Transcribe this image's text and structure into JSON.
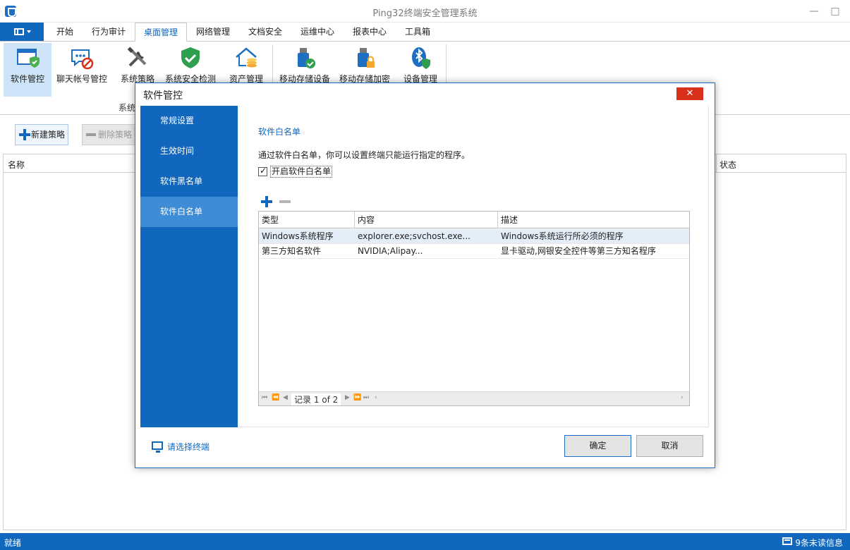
{
  "window": {
    "title": "Ping32终端安全管理系统",
    "minimize": "—",
    "maximize": "□",
    "close": "✕"
  },
  "menu": {
    "tabs": [
      "开始",
      "行为审计",
      "桌面管理",
      "网络管理",
      "文档安全",
      "运维中心",
      "报表中心",
      "工具箱"
    ],
    "active_tab": "桌面管理"
  },
  "ribbon": {
    "items": [
      {
        "label": "软件管控",
        "icon": "software-control-icon"
      },
      {
        "label": "聊天帐号管控",
        "icon": "chat-account-icon"
      },
      {
        "label": "系统策略",
        "icon": "tools-icon"
      },
      {
        "label": "系统安全检测",
        "icon": "shield-check-icon"
      },
      {
        "label": "资产管理",
        "icon": "asset-house-icon"
      },
      {
        "label": "移动存储设备",
        "icon": "usb-check-icon"
      },
      {
        "label": "移动存储加密",
        "icon": "usb-lock-icon"
      },
      {
        "label": "设备管理",
        "icon": "bluetooth-shield-icon"
      }
    ],
    "group_label": "系统"
  },
  "toolbar": {
    "new_policy": "新建策略",
    "delete_policy": "删除策略"
  },
  "grid": {
    "col_name": "名称",
    "col_status": "状态"
  },
  "dialog": {
    "title": "软件管控",
    "close": "✕",
    "side_items": [
      "常规设置",
      "生效时间",
      "软件黑名单",
      "软件白名单"
    ],
    "active_side": "软件白名单",
    "section_title": "软件白名单",
    "description": "通过软件白名单，你可以设置终端只能运行指定的程序。",
    "checkbox_label": "开启软件白名单",
    "table": {
      "headers": [
        "类型",
        "内容",
        "描述"
      ],
      "rows": [
        [
          "Windows系统程序",
          "explorer.exe;svchost.exe...",
          "Windows系统运行所必须的程序"
        ],
        [
          "第三方知名软件",
          "NVIDIA;Alipay...",
          "显卡驱动,网银安全控件等第三方知名程序"
        ]
      ],
      "pager_label": "记录 1 of 2"
    },
    "pick_terminal": "请选择终端",
    "ok": "确定",
    "cancel": "取消"
  },
  "status": {
    "left": "就绪",
    "right": "9条未读信息"
  },
  "colors": {
    "accent": "#1167bd",
    "close_red": "#d9301c",
    "active_side": "#3e8bd6"
  }
}
